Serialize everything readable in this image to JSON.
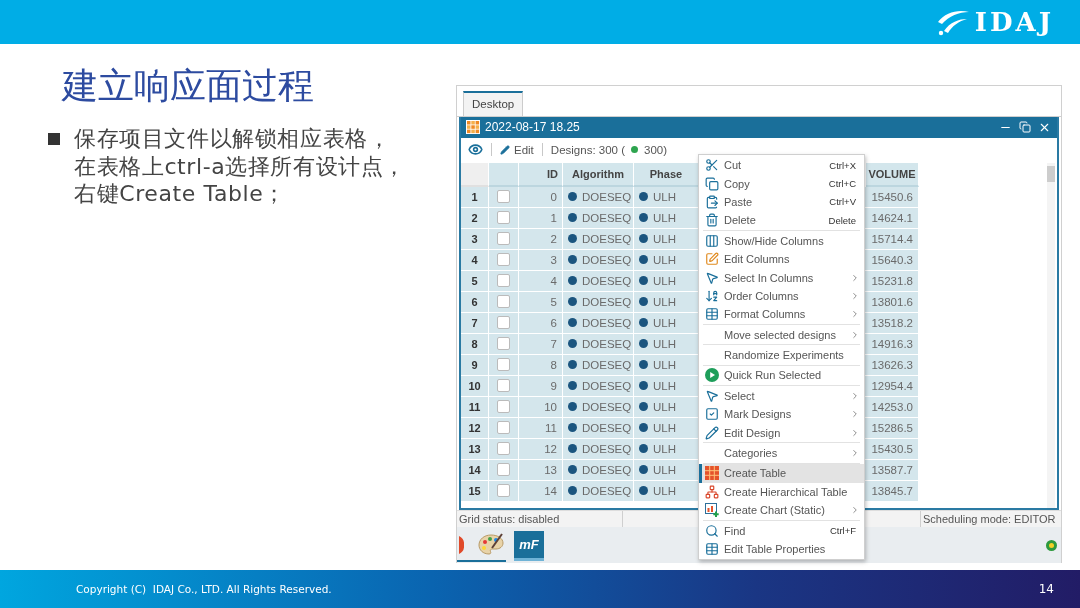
{
  "header": {
    "logo": "IDAJ"
  },
  "slide": {
    "title": "建立响应面过程",
    "bullets": [
      {
        "lines": [
          "保存项目文件以解锁相应表格，",
          "在表格上ctrl-a选择所有设计点，",
          "右键Create Table；"
        ]
      }
    ]
  },
  "app": {
    "tabs": [
      {
        "label": "Desktop",
        "selected": true
      }
    ],
    "window": {
      "title": "2022-08-17 18.25"
    },
    "toolbar": {
      "edit": "Edit",
      "designs": "Designs: 300 (",
      "designs_ok": "300)"
    },
    "table": {
      "columns": [
        {
          "label": "ID",
          "kind": "number"
        },
        {
          "label": "Algorithm",
          "kind": "tag"
        },
        {
          "label": "Phase",
          "kind": "tag"
        },
        {
          "label": "VOLUME",
          "kind": "number"
        }
      ],
      "rows": [
        {
          "number": "1",
          "checked": false,
          "selected": true,
          "cells": [
            "0",
            "DOESEQ",
            "ULH",
            "15450.6"
          ]
        },
        {
          "number": "2",
          "checked": false,
          "selected": true,
          "cells": [
            "1",
            "DOESEQ",
            "ULH",
            "14624.1"
          ]
        },
        {
          "number": "3",
          "checked": false,
          "selected": true,
          "cells": [
            "2",
            "DOESEQ",
            "ULH",
            "15714.4"
          ]
        },
        {
          "number": "4",
          "checked": false,
          "selected": true,
          "cells": [
            "3",
            "DOESEQ",
            "ULH",
            "15640.3"
          ]
        },
        {
          "number": "5",
          "checked": false,
          "selected": true,
          "cells": [
            "4",
            "DOESEQ",
            "ULH",
            "15231.8"
          ]
        },
        {
          "number": "6",
          "checked": false,
          "selected": true,
          "cells": [
            "5",
            "DOESEQ",
            "ULH",
            "13801.6"
          ]
        },
        {
          "number": "7",
          "checked": false,
          "selected": true,
          "cells": [
            "6",
            "DOESEQ",
            "ULH",
            "13518.2"
          ]
        },
        {
          "number": "8",
          "checked": false,
          "selected": true,
          "cells": [
            "7",
            "DOESEQ",
            "ULH",
            "14916.3"
          ]
        },
        {
          "number": "9",
          "checked": false,
          "selected": true,
          "cells": [
            "8",
            "DOESEQ",
            "ULH",
            "13626.3"
          ]
        },
        {
          "number": "10",
          "checked": false,
          "selected": true,
          "cells": [
            "9",
            "DOESEQ",
            "ULH",
            "12954.4"
          ]
        },
        {
          "number": "11",
          "checked": false,
          "selected": true,
          "cells": [
            "10",
            "DOESEQ",
            "ULH",
            "14253.0"
          ]
        },
        {
          "number": "12",
          "checked": false,
          "selected": true,
          "cells": [
            "11",
            "DOESEQ",
            "ULH",
            "15286.5"
          ]
        },
        {
          "number": "13",
          "checked": false,
          "selected": true,
          "cells": [
            "12",
            "DOESEQ",
            "ULH",
            "15430.5"
          ]
        },
        {
          "number": "14",
          "checked": false,
          "selected": true,
          "cells": [
            "13",
            "DOESEQ",
            "ULH",
            "13587.7"
          ]
        },
        {
          "number": "15",
          "checked": false,
          "selected": true,
          "cells": [
            "14",
            "DOESEQ",
            "ULH",
            "13845.7"
          ]
        }
      ]
    },
    "status_bar": {
      "left": "Grid status: disabled",
      "right": "Scheduling mode: EDITOR"
    },
    "taskbar": {
      "app_label": "mF"
    },
    "context_menu": {
      "groups": [
        [
          {
            "label": "Cut",
            "shortcut": "Ctrl+X",
            "submenu": false,
            "selected": false
          },
          {
            "label": "Copy",
            "shortcut": "Ctrl+C",
            "submenu": false,
            "selected": false
          },
          {
            "label": "Paste",
            "shortcut": "Ctrl+V",
            "submenu": false,
            "selected": false
          },
          {
            "label": "Delete",
            "shortcut": "Delete",
            "submenu": false,
            "selected": false
          }
        ],
        [
          {
            "label": "Show/Hide Columns",
            "submenu": false,
            "selected": false
          },
          {
            "label": "Edit Columns",
            "submenu": false,
            "selected": false
          },
          {
            "label": "Select In Columns",
            "submenu": true,
            "selected": false
          },
          {
            "label": "Order Columns",
            "submenu": true,
            "selected": false
          },
          {
            "label": "Format Columns",
            "submenu": true,
            "selected": false
          }
        ],
        [
          {
            "label": "Move selected designs",
            "submenu": true,
            "selected": false
          }
        ],
        [
          {
            "label": "Randomize Experiments",
            "submenu": false,
            "selected": false
          }
        ],
        [
          {
            "label": "Quick Run Selected",
            "submenu": false,
            "selected": false
          }
        ],
        [
          {
            "label": "Select",
            "submenu": true,
            "selected": false
          },
          {
            "label": "Mark Designs",
            "submenu": true,
            "selected": false
          },
          {
            "label": "Edit Design",
            "submenu": true,
            "selected": false
          }
        ],
        [
          {
            "label": "Categories",
            "submenu": true,
            "selected": false
          }
        ],
        [
          {
            "label": "Create Table",
            "submenu": false,
            "selected": true
          },
          {
            "label": "Create Hierarchical Table",
            "submenu": false,
            "selected": false
          },
          {
            "label": "Create Chart (Static)",
            "submenu": true,
            "selected": false
          }
        ],
        [
          {
            "label": "Find",
            "shortcut": "Ctrl+F",
            "submenu": false,
            "selected": false
          },
          {
            "label": "Edit Table Properties",
            "submenu": false,
            "selected": false
          }
        ]
      ]
    }
  },
  "footer": {
    "copyright": "Copyright (C)  IDAJ Co., LTD. All Rights Reserved.",
    "page": "14"
  }
}
